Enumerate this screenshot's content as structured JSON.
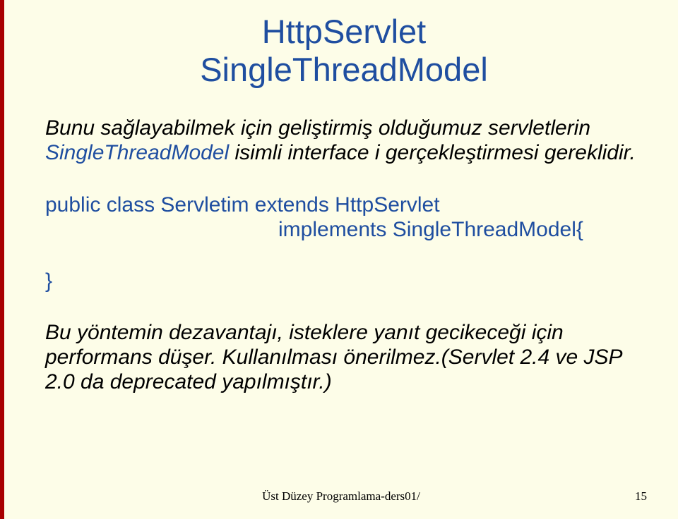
{
  "title_line1": "HttpServlet",
  "title_line2": "SingleThreadModel",
  "para1_pre": "Bunu sağlayabilmek için geliştirmiş olduğumuz servletlerin ",
  "para1_kw": "SingleThreadModel",
  "para1_post": " isimli interface i gerçekleştirmesi gereklidir.",
  "code_line1": "public class Servletim extends HttpServlet",
  "code_line2": "implements SingleThreadModel{",
  "close_brace": "}",
  "para2": "Bu yöntemin dezavantajı, isteklere yanıt gecikeceği için performans düşer. Kullanılması önerilmez.(Servlet 2.4 ve JSP 2.0 da deprecated yapılmıştır.)",
  "footer": "Üst Düzey Programlama-ders01/",
  "page_number": "15"
}
